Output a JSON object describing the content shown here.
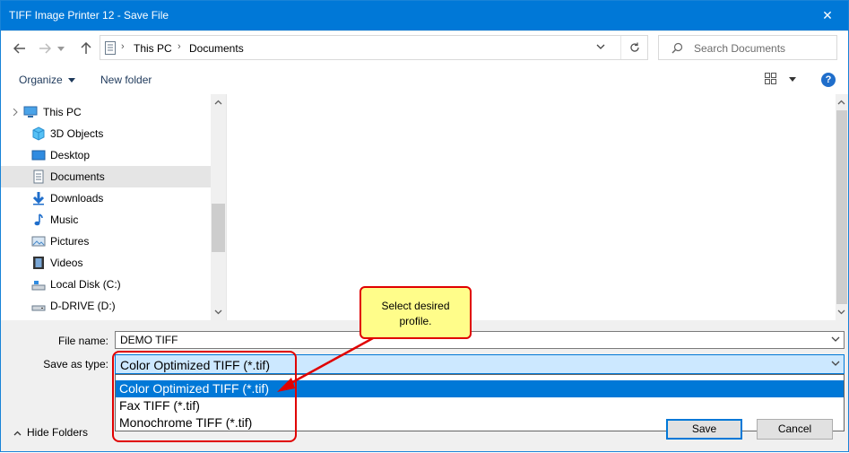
{
  "window": {
    "title": "TIFF Image Printer 12 - Save File",
    "close_glyph": "✕"
  },
  "nav": {
    "back_icon": "arrow-left-icon",
    "forward_icon": "arrow-right-icon",
    "up_icon": "arrow-up-icon",
    "breadcrumb": [
      "This PC",
      "Documents"
    ],
    "breadcrumb_sep": "›",
    "refresh_icon": "refresh-icon",
    "search_placeholder": "Search Documents"
  },
  "toolbar": {
    "organize": "Organize",
    "new_folder": "New folder",
    "help": "?"
  },
  "sidebar": {
    "items": [
      {
        "label": "This PC",
        "icon": "computer-icon"
      },
      {
        "label": "3D Objects",
        "icon": "cube-icon"
      },
      {
        "label": "Desktop",
        "icon": "desktop-icon"
      },
      {
        "label": "Documents",
        "icon": "document-icon",
        "selected": true
      },
      {
        "label": "Downloads",
        "icon": "download-icon"
      },
      {
        "label": "Music",
        "icon": "music-icon"
      },
      {
        "label": "Pictures",
        "icon": "pictures-icon"
      },
      {
        "label": "Videos",
        "icon": "video-icon"
      },
      {
        "label": "Local Disk (C:)",
        "icon": "drive-icon"
      },
      {
        "label": "D-DRIVE (D:)",
        "icon": "drive-icon"
      }
    ]
  },
  "form": {
    "file_name_label": "File name:",
    "file_name_value": "DEMO TIFF",
    "save_as_type_label": "Save as type:",
    "save_as_type_value": "Color Optimized TIFF (*.tif)",
    "type_options": [
      "Color Optimized TIFF (*.tif)",
      "Fax TIFF (*.tif)",
      "Monochrome TIFF (*.tif)"
    ]
  },
  "callout": {
    "line1": "Select desired",
    "line2": "profile."
  },
  "footer": {
    "hide_folders": "Hide Folders",
    "save": "Save",
    "cancel": "Cancel"
  },
  "colors": {
    "accent": "#0078d7",
    "highlight_red": "#e00000",
    "callout_fill": "#fffd8a"
  }
}
